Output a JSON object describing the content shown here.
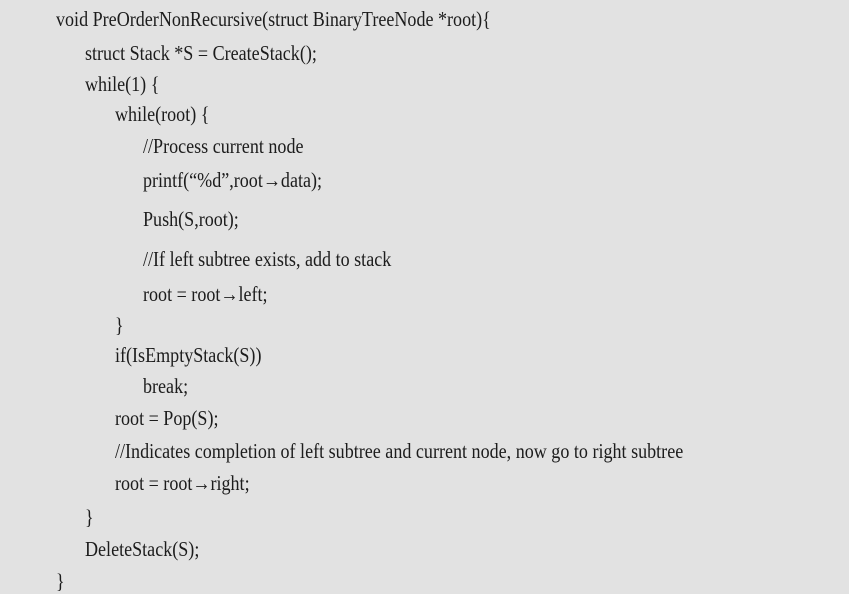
{
  "code": {
    "lines": [
      "void PreOrderNonRecursive(struct BinaryTreeNode *root){",
      "struct Stack *S = CreateStack();",
      "while(1) {",
      "while(root) {",
      "//Process current node",
      "printf(“%d”,root→data);",
      "Push(S,root);",
      "//If left subtree exists, add to stack",
      "root = root→left;",
      "}",
      "if(IsEmptyStack(S))",
      "break;",
      "root = Pop(S);",
      "//Indicates completion of left subtree and current node, now go to right subtree",
      "root = root→right;",
      "}",
      "DeleteStack(S);",
      "}"
    ]
  }
}
